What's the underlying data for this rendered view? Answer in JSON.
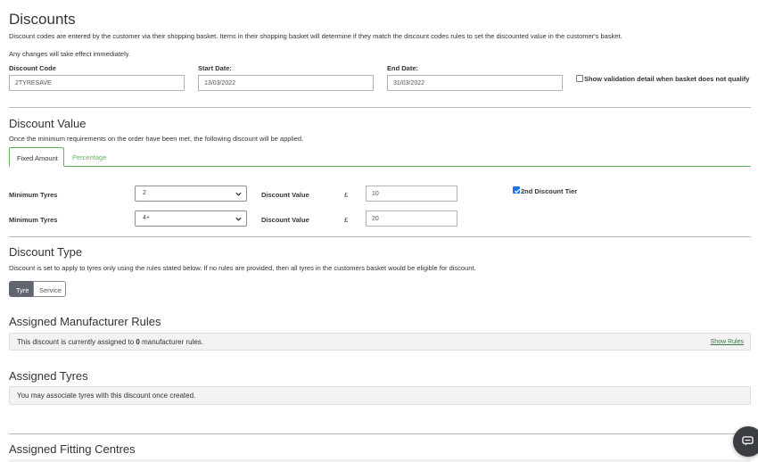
{
  "header": {
    "title": "Discounts",
    "description": "Discount codes are entered by the customer via their shopping basket. Items in their shopping basket will determine if they match the discount codes rules to set the discounted value in the customer's basket.",
    "notice": "Any changes will take effect immediately."
  },
  "form": {
    "discount_code": {
      "label": "Discount Code",
      "value": "2TYRESAVE"
    },
    "start_date": {
      "label": "Start Date:",
      "value": "13/03/2022"
    },
    "end_date": {
      "label": "End Date:",
      "value": "31/03/2022"
    },
    "show_validation": {
      "label": "Show validation detail when basket does not qualify",
      "checked": false
    }
  },
  "discount_value": {
    "title": "Discount Value",
    "description": "Once the minimum requirements on the order have been met, the following discount will be applied.",
    "tabs": [
      {
        "label": "Fixed Amount",
        "active": true
      },
      {
        "label": "Percentage",
        "active": false
      }
    ],
    "rows": [
      {
        "min_label": "Minimum Tyres",
        "min_value": "2",
        "value_label": "Discount Value",
        "currency": "£",
        "value": "10"
      },
      {
        "min_label": "Minimum Tyres",
        "min_value": "4+",
        "value_label": "Discount Value",
        "currency": "£",
        "value": "20"
      }
    ],
    "second_tier": {
      "label": "2nd Discount Tier",
      "checked": true
    }
  },
  "discount_type": {
    "title": "Discount Type",
    "description": "Discount is set to apply to tyres only using the rules stated below. If no rules are provided, then all tyres in the customers basket would be eligible for discount.",
    "options": [
      {
        "label": "Tyre",
        "active": true
      },
      {
        "label": "Service",
        "active": false
      }
    ]
  },
  "manufacturer_rules": {
    "title": "Assigned Manufacturer Rules",
    "text_prefix": "This discount is currently assigned to ",
    "count": "0",
    "text_suffix": " manufacturer rules.",
    "link": "Show Rules"
  },
  "assigned_tyres": {
    "title": "Assigned Tyres",
    "text": "You may associate tyres with this discount once created."
  },
  "fitting_centres": {
    "title": "Assigned Fitting Centres"
  },
  "colors": {
    "accent_green": "#5cb85c",
    "toggle_active": "#5f6670",
    "checkbox_blue": "#1a73e8"
  },
  "icons": {
    "chat": "chat-icon",
    "select": "chevron-down-icon"
  }
}
